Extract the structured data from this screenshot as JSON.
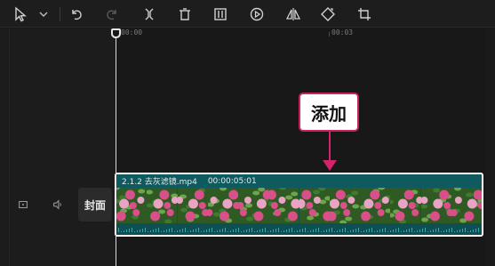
{
  "toolbar": {
    "tools": [
      {
        "name": "select-tool-icon"
      },
      {
        "name": "select-dropdown-icon"
      },
      {
        "name": "undo-icon"
      },
      {
        "name": "redo-icon"
      },
      {
        "name": "split-icon"
      },
      {
        "name": "delete-icon"
      },
      {
        "name": "freeze-frame-icon"
      },
      {
        "name": "play-reverse-icon"
      },
      {
        "name": "mirror-icon"
      },
      {
        "name": "rotate-icon"
      },
      {
        "name": "crop-icon"
      }
    ]
  },
  "ruler": {
    "labels": [
      "00:00",
      "00:03"
    ]
  },
  "callout": {
    "text": "添加"
  },
  "track_header": {
    "cover_label": "封面",
    "icons": [
      "track-lock-icon",
      "track-audio-icon"
    ]
  },
  "clip": {
    "name": "2.1.2 去灰滤镜.mp4",
    "duration": "00:00:05:01",
    "thumbnail_count": 12
  },
  "colors": {
    "accent": "#d4236a",
    "clip_bg": "#0c4d52",
    "flower": "#d94f8a",
    "leaf": "#3f7a2e"
  }
}
